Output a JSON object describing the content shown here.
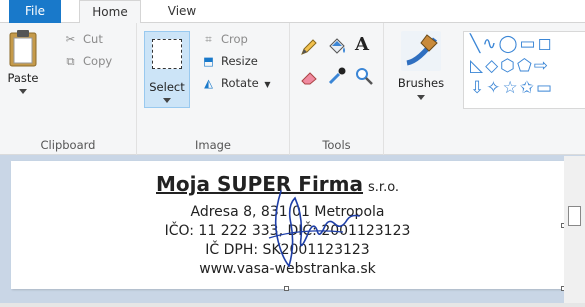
{
  "tabs": {
    "file": "File",
    "home": "Home",
    "view": "View"
  },
  "clipboard": {
    "paste": "Paste",
    "cut": "Cut",
    "copy": "Copy",
    "group_label": "Clipboard"
  },
  "image": {
    "select": "Select",
    "crop": "Crop",
    "resize": "Resize",
    "rotate": "Rotate",
    "group_label": "Image"
  },
  "tools": {
    "group_label": "Tools",
    "text_tool_glyph": "A"
  },
  "brushes": {
    "label": "Brushes"
  },
  "shapes": {
    "row1": "╲∿◯▭◻",
    "row2": "◺◇⬡⬠⇨",
    "row3": "⇩✧☆✩▭"
  },
  "document": {
    "company": "Moja SUPER Firma",
    "suffix": "s.r.o.",
    "address": "Adresa 8, 831 01 Metropola",
    "ids": "IČO: 11 222 333, DIČ: 2001123123",
    "vat": "IČ DPH: SK2001123123",
    "web": "www.vasa-webstranka.sk"
  },
  "colors": {
    "accent": "#1979ca",
    "select_bg": "#cce4f7",
    "signature": "#1f3fa8"
  }
}
